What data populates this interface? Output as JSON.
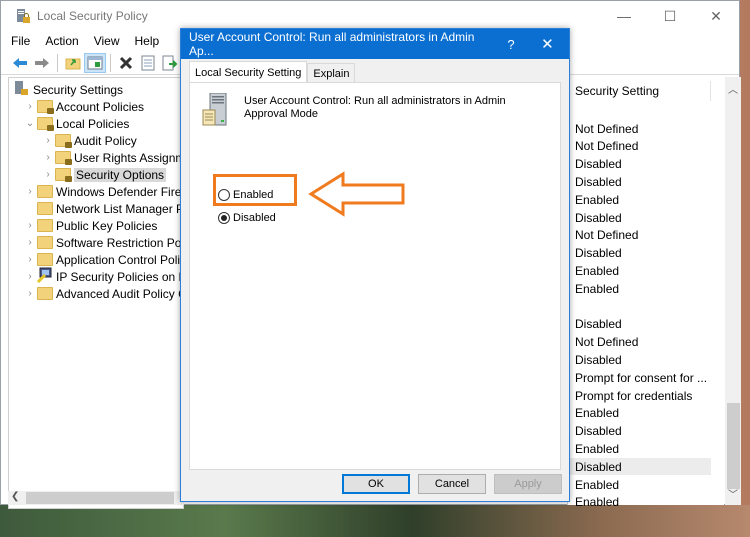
{
  "main_window": {
    "title": "Local Security Policy",
    "controls": {
      "minimize": "—",
      "maximize": "☐",
      "close": "✕"
    },
    "menu": [
      "File",
      "Action",
      "View",
      "Help"
    ],
    "toolbar": [
      {
        "icon": "back-arrow-icon",
        "glyph": "🡄"
      },
      {
        "icon": "forward-arrow-icon",
        "glyph": "🡆"
      },
      {
        "icon": "up-folder-icon",
        "glyph": "📁"
      },
      {
        "icon": "show-hide-console-tree-icon",
        "glyph": "▣"
      },
      {
        "icon": "delete-icon",
        "glyph": "✖"
      },
      {
        "icon": "properties-icon",
        "glyph": "▤"
      },
      {
        "icon": "export-list-icon",
        "glyph": "⇨"
      }
    ]
  },
  "tree": {
    "items": [
      {
        "label": "Security Settings",
        "chevron": "",
        "icon": "security-settings-icon",
        "level": 0
      },
      {
        "label": "Account Policies",
        "chevron": "›",
        "icon": "locked-folder-icon",
        "level": 1
      },
      {
        "label": "Local Policies",
        "chevron": "⌄",
        "icon": "locked-folder-icon",
        "level": 1
      },
      {
        "label": "Audit Policy",
        "chevron": "›",
        "icon": "locked-folder-icon",
        "level": 2
      },
      {
        "label": "User Rights Assignmen",
        "chevron": "›",
        "icon": "locked-folder-icon",
        "level": 2
      },
      {
        "label": "Security Options",
        "chevron": "›",
        "icon": "locked-folder-icon",
        "level": 2,
        "selected": true
      },
      {
        "label": "Windows Defender Firewal",
        "chevron": "›",
        "icon": "folder-icon",
        "level": 1
      },
      {
        "label": "Network List Manager Poli",
        "chevron": "",
        "icon": "folder-icon",
        "level": 1
      },
      {
        "label": "Public Key Policies",
        "chevron": "›",
        "icon": "folder-icon",
        "level": 1
      },
      {
        "label": "Software Restriction Polici",
        "chevron": "›",
        "icon": "folder-icon",
        "level": 1
      },
      {
        "label": "Application Control Polici",
        "chevron": "›",
        "icon": "folder-icon",
        "level": 1
      },
      {
        "label": "IP Security Policies on Loca",
        "chevron": "›",
        "icon": "ip-security-icon",
        "level": 1
      },
      {
        "label": "Advanced Audit Policy Co",
        "chevron": "›",
        "icon": "folder-icon",
        "level": 1
      }
    ]
  },
  "list": {
    "header": "Security Setting",
    "rows": [
      "Not Defined",
      "Not Defined",
      "Disabled",
      "Disabled",
      "Enabled",
      "Disabled",
      "Not Defined",
      "Disabled",
      "Enabled",
      "Enabled",
      "",
      "Disabled",
      "Not Defined",
      "Disabled",
      "Prompt for consent for ...",
      "Prompt for credentials",
      "Enabled",
      "Disabled",
      "Enabled",
      "Disabled",
      "Enabled",
      "Enabled"
    ],
    "selected_index": 19
  },
  "dialog": {
    "title": "User Account Control: Run all administrators in Admin Ap...",
    "help": "?",
    "close": "✕",
    "tabs": [
      "Local Security Setting",
      "Explain"
    ],
    "active_tab": 0,
    "policy_name": "User Account Control: Run all administrators in Admin Approval Mode",
    "options": [
      {
        "label": "Enabled",
        "checked": false
      },
      {
        "label": "Disabled",
        "checked": true
      }
    ],
    "buttons": {
      "ok": "OK",
      "cancel": "Cancel",
      "apply": "Apply"
    },
    "annotation_color": "#f07b1f",
    "title_color": "#0b6fd2"
  }
}
